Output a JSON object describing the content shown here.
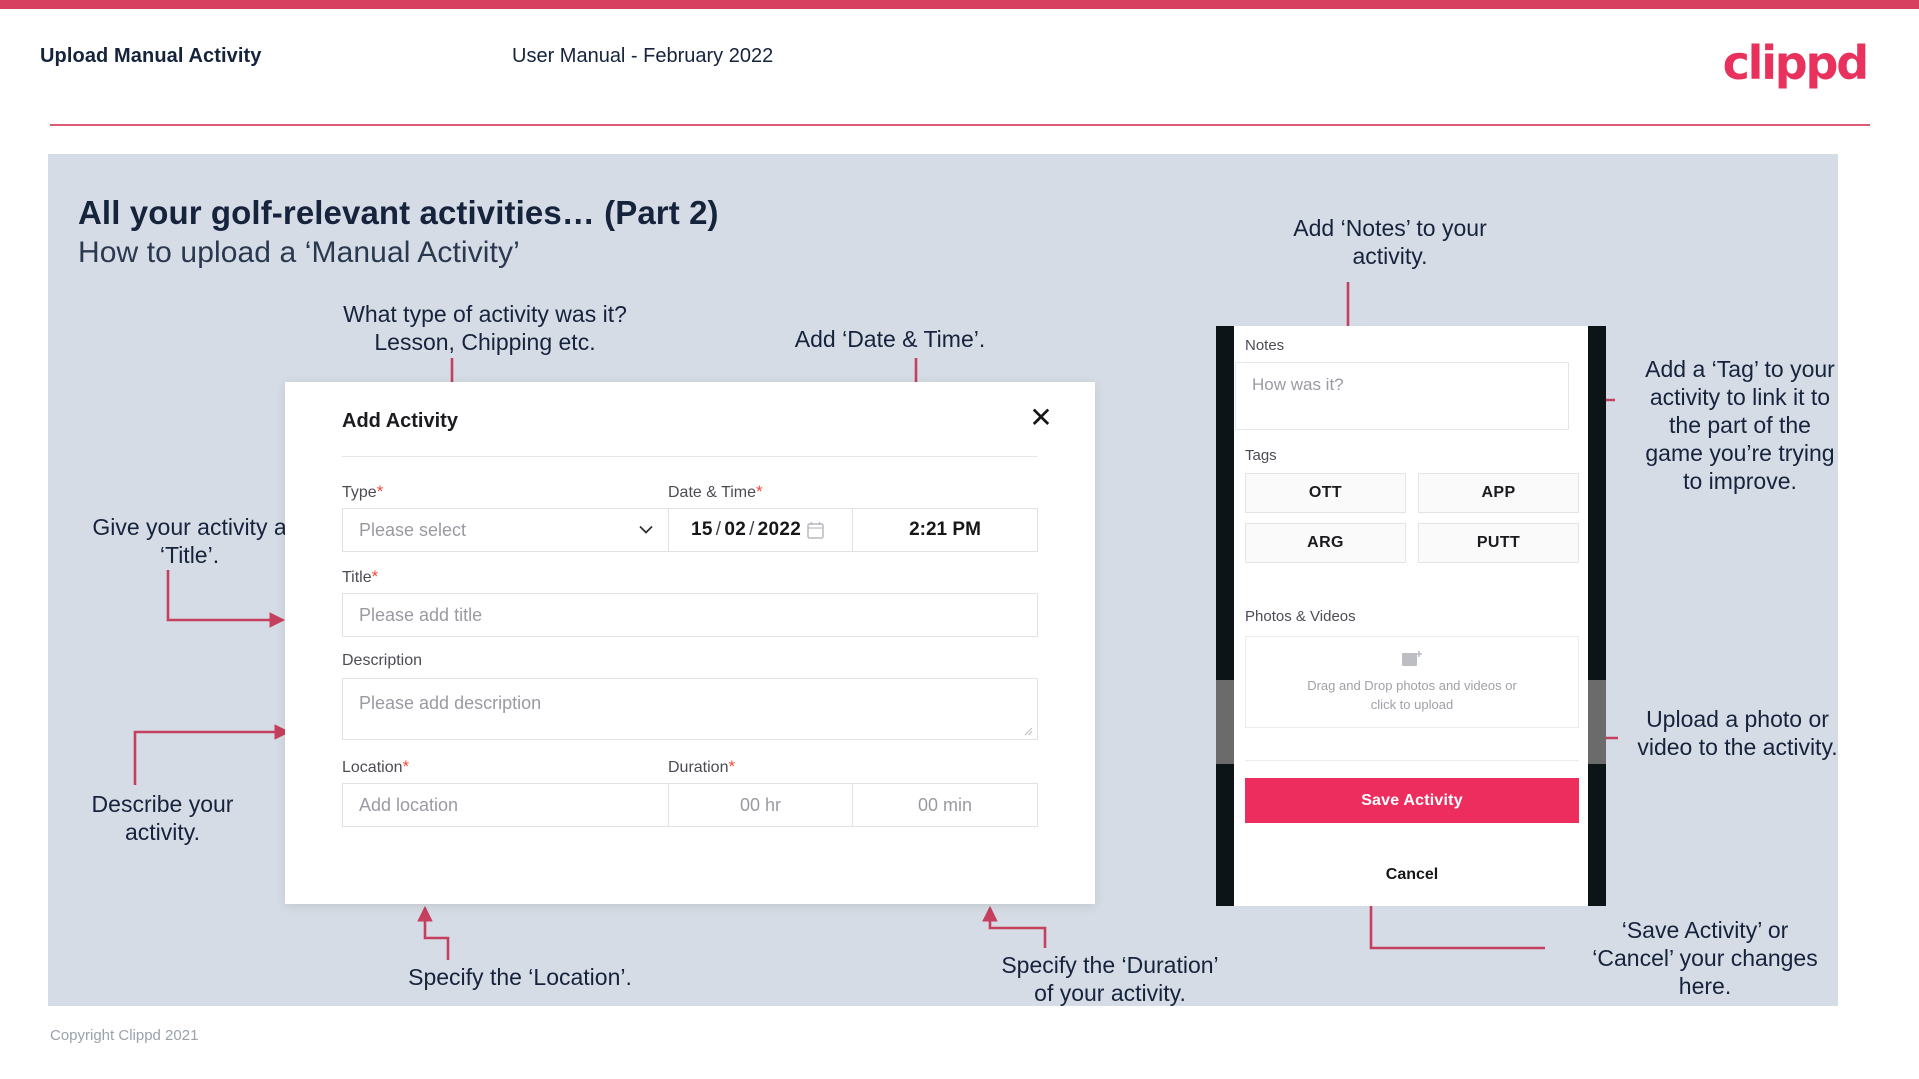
{
  "header": {
    "left_title": "Upload Manual Activity",
    "center_title": "User Manual - February 2022",
    "logo": "clippd"
  },
  "slide": {
    "title_bold": "All your golf-relevant activities… (Part 2)",
    "title_regular": "How to upload a ‘Manual Activity’",
    "copyright": "Copyright Clippd 2021"
  },
  "annotations": {
    "type": "What type of activity was it?\nLesson, Chipping etc.",
    "datetime": "Add ‘Date & Time’.",
    "title": "Give your activity a\n‘Title’.",
    "description": "Describe your\nactivity.",
    "location": "Specify the ‘Location’.",
    "duration": "Specify the ‘Duration’\nof your activity.",
    "notes": "Add ‘Notes’ to your\nactivity.",
    "tags": "Add a ‘Tag’ to your\nactivity to link it to\nthe part of the\ngame you’re trying\nto improve.",
    "upload": "Upload a photo or\nvideo to the activity.",
    "save_cancel": "‘Save Activity’ or\n‘Cancel’ your changes\nhere."
  },
  "dialog": {
    "title": "Add Activity",
    "close_label": "✕",
    "fields": {
      "type_label": "Type",
      "type_placeholder": "Please select",
      "datetime_label": "Date & Time",
      "date_day": "15",
      "date_month": "02",
      "date_year": "2022",
      "time_value": "2:21 PM",
      "title_label": "Title",
      "title_placeholder": "Please add title",
      "description_label": "Description",
      "description_placeholder": "Please add description",
      "location_label": "Location",
      "location_placeholder": "Add location",
      "duration_label": "Duration",
      "duration_hours": "00 hr",
      "duration_minutes": "00 min"
    },
    "required_mark": "*"
  },
  "phone": {
    "notes_label": "Notes",
    "notes_placeholder": "How was it?",
    "tags_label": "Tags",
    "tags": [
      "OTT",
      "APP",
      "ARG",
      "PUTT"
    ],
    "photos_label": "Photos & Videos",
    "dropzone_text": "Drag and Drop photos and videos or\nclick to upload",
    "save_label": "Save Activity",
    "cancel_label": "Cancel"
  },
  "colors": {
    "brand_pink": "#e8315c",
    "accent_bar": "#d7405e",
    "arrow": "#c4405e",
    "panel_bg": "#d6dce5",
    "save_button": "#ec2d5e",
    "text_dark": "#16233c"
  }
}
